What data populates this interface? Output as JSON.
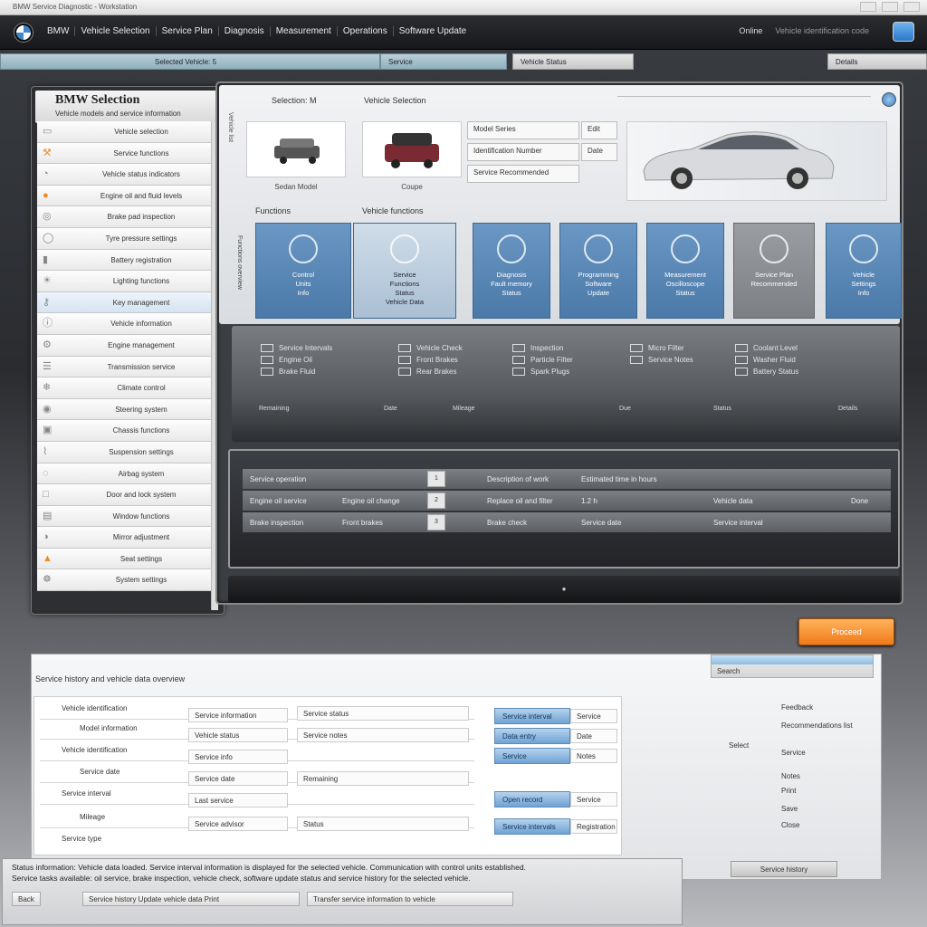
{
  "window": {
    "title": "BMW Service Diagnostic - Workstation",
    "controls": [
      "minimize",
      "maximize",
      "close"
    ]
  },
  "menubar": {
    "items": [
      "BMW",
      "Vehicle Selection",
      "Service Plan",
      "Diagnosis",
      "Measurement",
      "Operations",
      "Software Update"
    ],
    "right_label": "Online",
    "right_sub": "Vehicle identification code"
  },
  "tabs": [
    "Selected Vehicle: 5",
    "Service",
    "Vehicle Status",
    "Details"
  ],
  "sidebar": {
    "title": "BMW Selection",
    "subtitle": "Vehicle models and service information",
    "items": [
      {
        "icon": "car-icon",
        "label": "Vehicle selection",
        "accent": false
      },
      {
        "icon": "wrench-icon",
        "label": "Service functions",
        "accent": true
      },
      {
        "icon": "gauge-icon",
        "label": "Vehicle status indicators",
        "accent": false
      },
      {
        "icon": "oil-icon",
        "label": "Engine oil and fluid levels",
        "accent": true
      },
      {
        "icon": "brake-icon",
        "label": "Brake pad inspection",
        "accent": false
      },
      {
        "icon": "tyre-icon",
        "label": "Tyre pressure settings",
        "accent": false
      },
      {
        "icon": "battery-icon",
        "label": "Battery registration",
        "accent": false
      },
      {
        "icon": "light-icon",
        "label": "Lighting functions",
        "accent": false
      },
      {
        "icon": "key-icon",
        "label": "Key management",
        "accent": false
      },
      {
        "icon": "info-icon",
        "label": "Vehicle information",
        "accent": false
      },
      {
        "icon": "engine-icon",
        "label": "Engine management",
        "accent": false
      },
      {
        "icon": "transmission-icon",
        "label": "Transmission service",
        "accent": false
      },
      {
        "icon": "climate-icon",
        "label": "Climate control",
        "accent": false
      },
      {
        "icon": "steering-icon",
        "label": "Steering system",
        "accent": false
      },
      {
        "icon": "chassis-icon",
        "label": "Chassis functions",
        "accent": false
      },
      {
        "icon": "suspension-icon",
        "label": "Suspension settings",
        "accent": false
      },
      {
        "icon": "airbag-icon",
        "label": "Airbag system",
        "accent": false
      },
      {
        "icon": "door-icon",
        "label": "Door and lock system",
        "accent": false
      },
      {
        "icon": "window-icon",
        "label": "Window functions",
        "accent": false
      },
      {
        "icon": "mirror-icon",
        "label": "Mirror adjustment",
        "accent": false
      },
      {
        "icon": "seat-icon",
        "label": "Seat settings",
        "accent": true
      },
      {
        "icon": "settings-icon",
        "label": "System settings",
        "accent": false
      }
    ]
  },
  "main": {
    "crumb1": "Selection: M",
    "crumb2": "Vehicle Selection",
    "vtext": "Vehicle list",
    "vtext2": "Functions overview",
    "thumbs": [
      {
        "caption": "Sedan Model"
      },
      {
        "caption": "Coupe"
      }
    ],
    "fields": [
      "Model Series",
      "Identification Number",
      "Service Recommended"
    ],
    "field_tags": [
      "Edit",
      "Date"
    ],
    "section": "Functions",
    "section2": "Vehicle functions",
    "tiles": [
      {
        "label": [
          "Control",
          "Units",
          "Info"
        ],
        "style": "blue"
      },
      {
        "label": [
          "Service",
          "Functions",
          "Status",
          "Vehicle Data"
        ],
        "style": "pale"
      },
      {
        "label": [
          "Diagnosis",
          "Fault memory",
          "Status"
        ],
        "style": "blue"
      },
      {
        "label": [
          "Programming",
          "Software",
          "Update"
        ],
        "style": "blue"
      },
      {
        "label": [
          "Measurement",
          "Oscilloscope",
          "Status"
        ],
        "style": "blue"
      },
      {
        "label": [
          "Service Plan",
          "Recommended"
        ],
        "style": "grey"
      },
      {
        "label": [
          "Vehicle",
          "Settings",
          "Info"
        ],
        "style": "blue"
      }
    ],
    "band_groups": [
      {
        "lines": [
          "Service Intervals",
          "Engine Oil",
          "Brake Fluid"
        ]
      },
      {
        "lines": [
          "Vehicle Check",
          "Front Brakes",
          "Rear Brakes"
        ]
      },
      {
        "lines": [
          "Inspection",
          "Particle Filter",
          "Spark Plugs"
        ]
      },
      {
        "lines": [
          "Micro Filter",
          "Service Notes"
        ]
      },
      {
        "lines": [
          "Coolant Level",
          "Washer Fluid",
          "Battery Status"
        ]
      }
    ],
    "band_footer": [
      "Remaining",
      "Date",
      "Mileage",
      "Due",
      "Status",
      "Details"
    ],
    "table_rows": [
      {
        "c1": "Service operation",
        "btn": "1",
        "c2": "Description of work",
        "c3": "Estimated time in hours"
      },
      {
        "c1": "Engine oil service",
        "c1b": "Engine oil change",
        "btn": "2",
        "c2": "Replace oil and filter",
        "c3": "1.2 h",
        "c4": "Vehicle data",
        "c5": "Done"
      },
      {
        "c1": "Brake inspection",
        "c1b": "Front brakes",
        "btn": "3",
        "c2": "Brake check",
        "c3": "Service date",
        "c4": "Service interval"
      }
    ],
    "footer": "●"
  },
  "action_button": "Proceed",
  "form": {
    "title": "Service history and vehicle data overview",
    "search_label": "Search",
    "labels": [
      "Vehicle identification",
      "Model information",
      "Vehicle identification",
      "Service date",
      "Service interval",
      "Mileage",
      "Service type"
    ],
    "col2": [
      "Service information",
      "Vehicle status",
      "Service info",
      "Service date",
      "Last service",
      "Service advisor"
    ],
    "col3": [
      "Service status",
      "Service notes",
      "Remaining",
      "Status"
    ],
    "blue_buttons": [
      "Service interval",
      "Data entry",
      "Service",
      "Open record",
      "Service intervals"
    ],
    "blue_values": [
      "Service",
      "Date",
      "Notes",
      "Service",
      "Registration"
    ],
    "side_label": "Select",
    "side_value": "Search",
    "right": [
      "Feedback",
      "Recommendations list",
      "Service",
      "Notes",
      "Print",
      "Save",
      "Close"
    ],
    "footer_button": "Service history"
  },
  "status": {
    "line1": "Status information: Vehicle data loaded. Service interval information is displayed for the selected vehicle. Communication with control units established.",
    "line2": "Service tasks available: oil service, brake inspection, vehicle check, software update status and service history for the selected vehicle.",
    "buttons": [
      "Back",
      "Service history  Update vehicle data  Print",
      "Transfer service information to vehicle"
    ]
  }
}
